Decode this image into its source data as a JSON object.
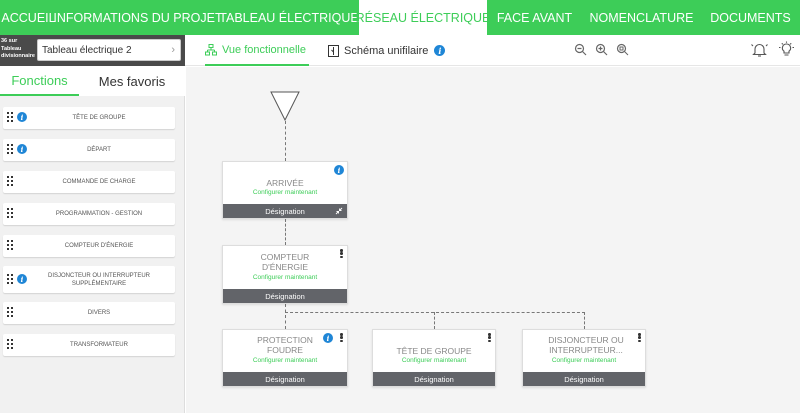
{
  "topnav": {
    "tabs": [
      {
        "label": "ACCUEIL"
      },
      {
        "label": "INFORMATIONS DU PROJET"
      },
      {
        "label": "TABLEAU ÉLECTRIQUE"
      },
      {
        "label": "RÉSEAU ÉLECTRIQUE"
      },
      {
        "label": "FACE AVANT"
      },
      {
        "label": "NOMENCLATURE"
      },
      {
        "label": "DOCUMENTS"
      }
    ],
    "active_index": 3
  },
  "panel_selector": {
    "small_lines": [
      "36 sur",
      "Tableau",
      "divisionnaire"
    ],
    "selected": "Tableau électrique 2"
  },
  "view_tabs": {
    "functional": "Vue fonctionnelle",
    "unifilar": "Schéma unifilaire"
  },
  "sidebar": {
    "tabs": [
      "Fonctions",
      "Mes favoris"
    ],
    "items": [
      {
        "label": "TÊTE DE GROUPE",
        "info": true
      },
      {
        "label": "DÉPART",
        "info": true
      },
      {
        "label": "COMMANDE DE CHARGE",
        "info": false
      },
      {
        "label": "PROGRAMMATION - GESTION",
        "info": false
      },
      {
        "label": "COMPTEUR D'ÉNERGIE",
        "info": false
      },
      {
        "label": "DISJONCTEUR OU INTERRUPTEUR SUPPLÉMENTAIRE",
        "info": true
      },
      {
        "label": "DIVERS",
        "info": false
      },
      {
        "label": "TRANSFORMATEUR",
        "info": false
      }
    ]
  },
  "nodes": {
    "arrivee": {
      "title": "ARRIVÉE",
      "config": "Configurer maintenant",
      "footer": "Désignation"
    },
    "compteur": {
      "title": "COMPTEUR D'ÉNERGIE",
      "config": "Configurer maintenant",
      "footer": "Désignation"
    },
    "protection": {
      "title": "PROTECTION FOUDRE",
      "config": "Configurer maintenant",
      "footer": "Désignation"
    },
    "tete": {
      "title": "TÊTE DE GROUPE",
      "config": "Configurer maintenant",
      "footer": "Désignation"
    },
    "disjoncteur": {
      "title": "DISJONCTEUR OU INTERRUPTEUR...",
      "config": "Configurer maintenant",
      "footer": "Désignation"
    }
  },
  "colors": {
    "accent": "#3dcd58",
    "info": "#1f86d6",
    "footer": "#626469"
  },
  "icons": {
    "info": "i"
  }
}
